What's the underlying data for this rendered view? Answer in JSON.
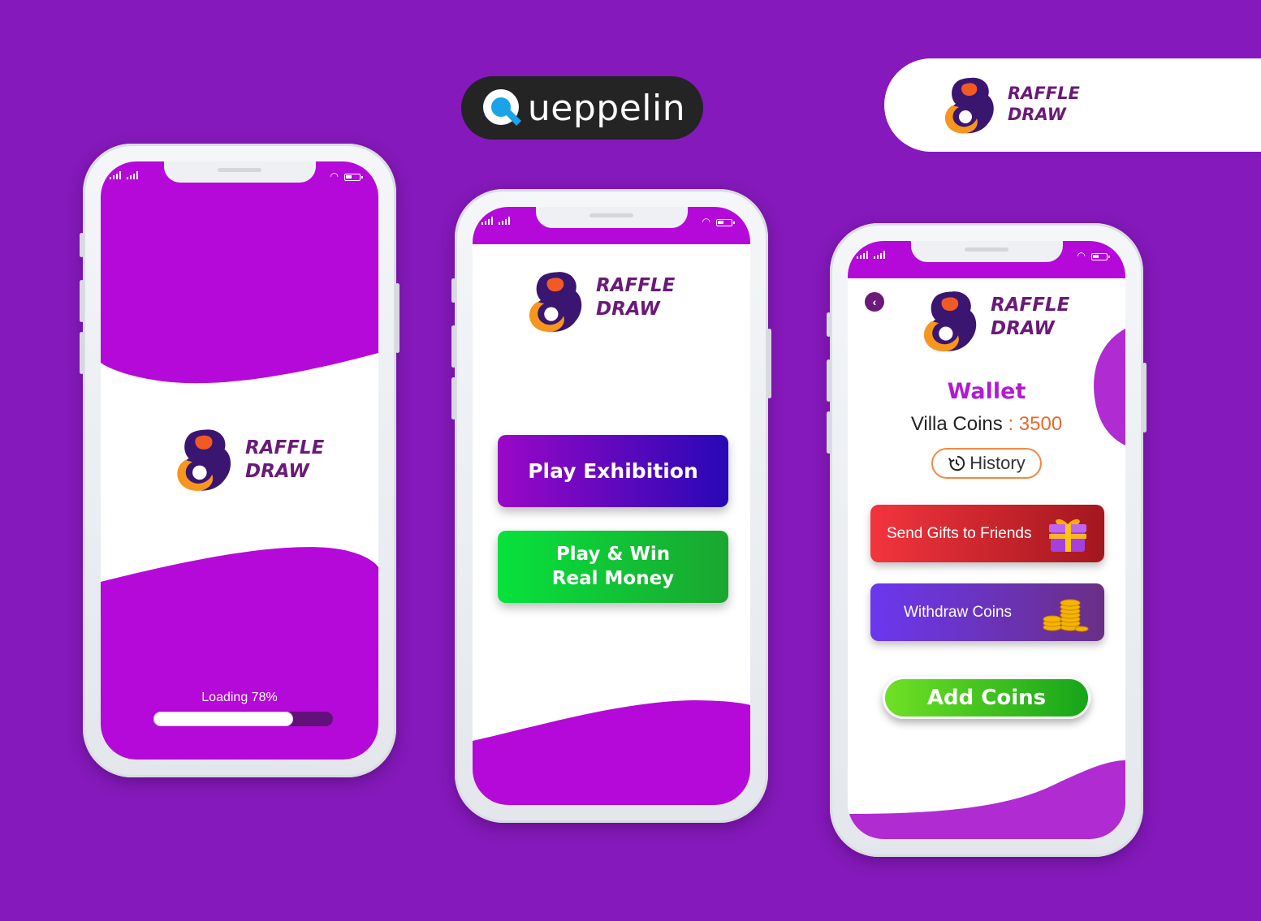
{
  "brand": {
    "name": "ueppelin"
  },
  "logo": {
    "line1": "RAFFLE",
    "line2": "DRAW"
  },
  "splash": {
    "loading_label": "Loading 78%",
    "progress": 0.78
  },
  "menu": {
    "exhibition_label": "Play Exhibition",
    "real_line1": "Play & Win",
    "real_line2": "Real Money"
  },
  "wallet": {
    "title": "Wallet",
    "coins_label": "Villa Coins",
    "coins_sep": ":",
    "coins_value": "3500",
    "history_label": "History",
    "send_gifts_label": "Send Gifts to Friends",
    "withdraw_label": "Withdraw Coins",
    "add_coins_label": "Add Coins"
  },
  "colors": {
    "background": "#8519bb",
    "accent": "#b409d8",
    "logo_text": "#6a1a78",
    "orange": "#ea6a2b"
  },
  "icons": [
    "signal-icon",
    "wifi-icon",
    "battery-icon",
    "back-arrow-icon",
    "history-icon",
    "gift-icon",
    "coins-icon",
    "raffle-logo-icon",
    "queppelin-q-icon"
  ]
}
